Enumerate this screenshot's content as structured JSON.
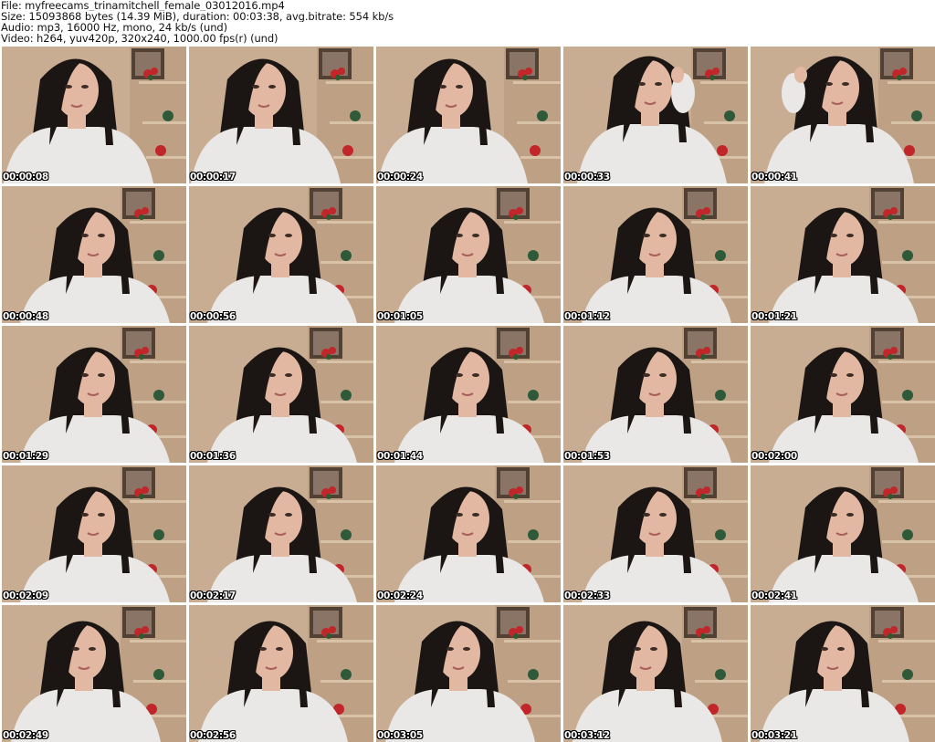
{
  "header": {
    "file_line": "File: myfreecams_trinamitchell_female_03012016.mp4",
    "size_line": "Size: 15093868 bytes (14.39 MiB), duration: 00:03:38, avg.bitrate: 554 kb/s",
    "audio_line": "Audio: mp3, 16000 Hz, mono, 24 kb/s (und)",
    "video_line": "Video: h264, yuv420p, 320x240, 1000.00 fps(r) (und)"
  },
  "colors": {
    "wall": "#c9ad92",
    "wall_dark": "#a88a6e",
    "shelf": "#d8c2a8",
    "hair": "#1b1513",
    "skin": "#e2b8a2",
    "sweater": "#e9e8e6",
    "flower_red": "#c0262a",
    "plant_green": "#2f5a3a",
    "frame": "#3d3026"
  },
  "thumbnails": [
    {
      "timestamp": "00:00:08",
      "variant": "a"
    },
    {
      "timestamp": "00:00:17",
      "variant": "a"
    },
    {
      "timestamp": "00:00:24",
      "variant": "a"
    },
    {
      "timestamp": "00:00:33",
      "variant": "b"
    },
    {
      "timestamp": "00:00:41",
      "variant": "b"
    },
    {
      "timestamp": "00:00:48",
      "variant": "c"
    },
    {
      "timestamp": "00:00:56",
      "variant": "c"
    },
    {
      "timestamp": "00:01:05",
      "variant": "c"
    },
    {
      "timestamp": "00:01:12",
      "variant": "c"
    },
    {
      "timestamp": "00:01:21",
      "variant": "c"
    },
    {
      "timestamp": "00:01:29",
      "variant": "c"
    },
    {
      "timestamp": "00:01:36",
      "variant": "c"
    },
    {
      "timestamp": "00:01:44",
      "variant": "c"
    },
    {
      "timestamp": "00:01:53",
      "variant": "c"
    },
    {
      "timestamp": "00:02:00",
      "variant": "c"
    },
    {
      "timestamp": "00:02:09",
      "variant": "c"
    },
    {
      "timestamp": "00:02:17",
      "variant": "c"
    },
    {
      "timestamp": "00:02:24",
      "variant": "c"
    },
    {
      "timestamp": "00:02:33",
      "variant": "c"
    },
    {
      "timestamp": "00:02:41",
      "variant": "c"
    },
    {
      "timestamp": "00:02:49",
      "variant": "d"
    },
    {
      "timestamp": "00:02:56",
      "variant": "d"
    },
    {
      "timestamp": "00:03:05",
      "variant": "d"
    },
    {
      "timestamp": "00:03:12",
      "variant": "d"
    },
    {
      "timestamp": "00:03:21",
      "variant": "d"
    }
  ]
}
